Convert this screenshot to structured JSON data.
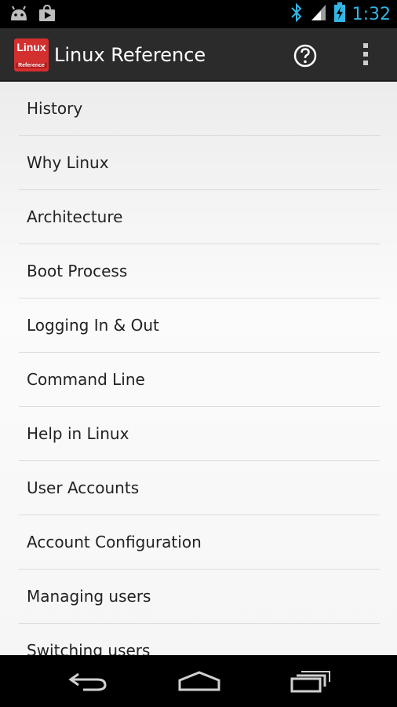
{
  "status_bar": {
    "time": "1:32",
    "icons": [
      "android-icon",
      "play-store-icon",
      "bluetooth-icon",
      "signal-icon",
      "battery-charging-icon"
    ],
    "accent_color": "#33b5e5"
  },
  "action_bar": {
    "logo_text_top": "Linux",
    "logo_text_bottom": "Reference",
    "title": "Linux Reference",
    "actions": [
      "help-icon",
      "overflow-menu-icon"
    ]
  },
  "menu": {
    "items": [
      {
        "label": "History"
      },
      {
        "label": "Why Linux"
      },
      {
        "label": "Architecture"
      },
      {
        "label": "Boot Process"
      },
      {
        "label": "Logging In & Out"
      },
      {
        "label": "Command Line"
      },
      {
        "label": "Help in Linux"
      },
      {
        "label": "User Accounts"
      },
      {
        "label": "Account Configuration"
      },
      {
        "label": "Managing users"
      },
      {
        "label": "Switching users"
      }
    ]
  },
  "nav_bar": {
    "buttons": [
      "back-icon",
      "home-icon",
      "recent-apps-icon"
    ]
  }
}
